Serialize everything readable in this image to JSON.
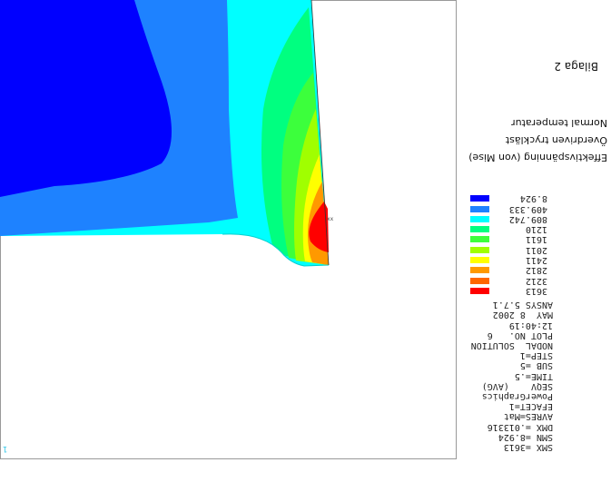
{
  "header": {
    "label": "Bilaga 2",
    "title_lines": [
      "Normal temperatur",
      "Överdriven tryckläst",
      "Effektivspänning (von Mise)"
    ]
  },
  "info_lines": [
    "ANSYS 5.7.1",
    "MAY  8 2002",
    "12:40:19",
    "PLOT NO.   6",
    "NODAL  SOLUTION",
    "STEP=1",
    "SUB =5",
    "TIME=.5",
    "SEQV    (AVG)",
    "PowerGraphics",
    "EFACET=1",
    "AVRES=Mat",
    "DMX =.013316",
    "SMN =8.924",
    "SMX =3613"
  ],
  "legend": [
    {
      "value": "8.924",
      "color": "#0000ff"
    },
    {
      "value": "409.333",
      "color": "#1e82ff"
    },
    {
      "value": "809.742",
      "color": "#00ffff"
    },
    {
      "value": "1210",
      "color": "#00ff80"
    },
    {
      "value": "1611",
      "color": "#3cff3c"
    },
    {
      "value": "2011",
      "color": "#a0ff00"
    },
    {
      "value": "2411",
      "color": "#ffff00"
    },
    {
      "value": "2812",
      "color": "#ff9900"
    },
    {
      "value": "3212",
      "color": "#ff6600"
    },
    {
      "value": "3613",
      "color": "#ff0000"
    }
  ],
  "plot": {
    "triad_label": "1",
    "node_marker": "xx"
  },
  "colors": {
    "band_blue": "#0000ff",
    "band_lightblue": "#1e82ff",
    "band_cyan": "#00ffff",
    "band_green": "#00ff80",
    "band_green2": "#3cff3c",
    "band_yellowgreen": "#a0ff00",
    "band_yellow": "#ffff00",
    "band_orange": "#ff9900",
    "band_red": "#ff0000"
  }
}
